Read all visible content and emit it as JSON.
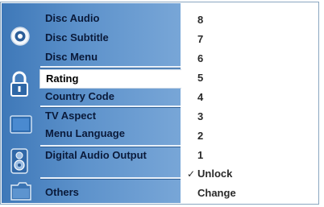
{
  "menu": {
    "items": [
      {
        "label": "Disc Audio"
      },
      {
        "label": "Disc Subtitle"
      },
      {
        "label": "Disc Menu"
      },
      {
        "label": "Rating",
        "selected": true
      },
      {
        "label": "Country Code"
      },
      {
        "label": "TV Aspect"
      },
      {
        "label": "Menu Language"
      },
      {
        "label": "Digital Audio Output"
      },
      {
        "label": "Others"
      }
    ],
    "icons": [
      "disc-icon",
      "padlock-icon",
      "tv-screen-icon",
      "speaker-icon",
      "folder-icon"
    ]
  },
  "options": {
    "items": [
      {
        "label": "8"
      },
      {
        "label": "7"
      },
      {
        "label": "6"
      },
      {
        "label": "5"
      },
      {
        "label": "4"
      },
      {
        "label": "3"
      },
      {
        "label": "2"
      },
      {
        "label": "1"
      },
      {
        "label": "Unlock",
        "checked": true
      },
      {
        "label": "Change"
      }
    ],
    "check_mark": "✓"
  },
  "colors": {
    "panel_blue": "#4f86c3",
    "highlight": "#ffffff",
    "text": "#0a1a3a"
  }
}
